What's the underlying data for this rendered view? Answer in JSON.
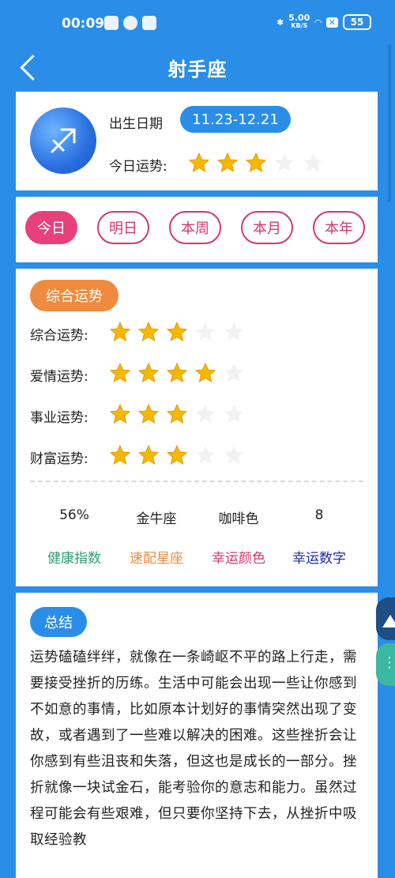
{
  "status_bar": {
    "time": "00:09",
    "net_speed": "5.00",
    "net_unit": "KB/S",
    "battery": "55"
  },
  "header": {
    "title": "射手座"
  },
  "profile": {
    "birth_label": "出生日期",
    "birth_range": "11.23-12.21",
    "today_label": "今日运势:",
    "today_stars": 3
  },
  "tabs": [
    {
      "label": "今日",
      "active": true
    },
    {
      "label": "明日",
      "active": false
    },
    {
      "label": "本周",
      "active": false
    },
    {
      "label": "本月",
      "active": false
    },
    {
      "label": "本年",
      "active": false
    }
  ],
  "fortune": {
    "badge": "综合运势",
    "rows": [
      {
        "label": "综合运势:",
        "stars": 3
      },
      {
        "label": "爱情运势:",
        "stars": 4
      },
      {
        "label": "事业运势:",
        "stars": 3
      },
      {
        "label": "财富运势:",
        "stars": 3
      }
    ],
    "stats": [
      {
        "value": "56%",
        "label": "健康指数",
        "color": "#2e9c7a"
      },
      {
        "value": "金牛座",
        "label": "速配星座",
        "color": "#ef8b3f"
      },
      {
        "value": "咖啡色",
        "label": "幸运颜色",
        "color": "#d2396b"
      },
      {
        "value": "8",
        "label": "幸运数字",
        "color": "#1f2f9e"
      }
    ]
  },
  "summary": {
    "badge": "总结",
    "text": "运势磕磕绊绊，就像在一条崎岖不平的路上行走，需要接受挫折的历练。生活中可能会出现一些让你感到不如意的事情，比如原本计划好的事情突然出现了变故，或者遇到了一些难以解决的困难。这些挫折会让你感到有些沮丧和失落，但这也是成长的一部分。挫折就像一块试金石，能考验你的意志和能力。虽然过程可能会有些艰难，但只要你坚持下去，从挫折中吸取经验教"
  },
  "colors": {
    "primary": "#2a8ee8",
    "star_filled": "#f5b800",
    "star_empty": "#f2f2f2",
    "tab_active": "#e8407a",
    "tab_border": "#d2396b"
  }
}
